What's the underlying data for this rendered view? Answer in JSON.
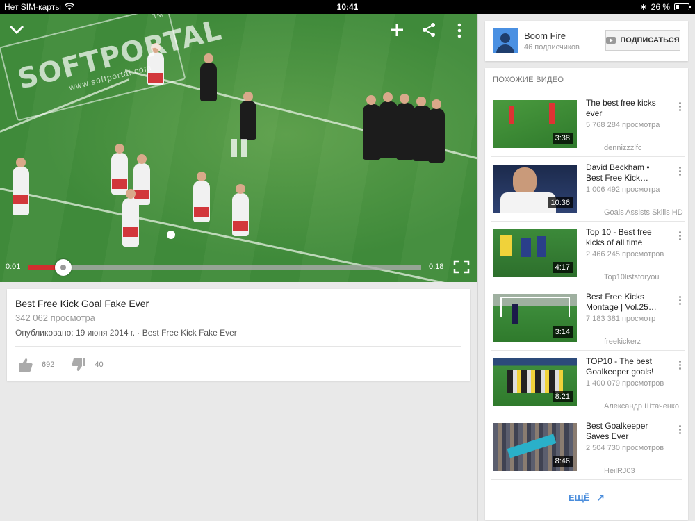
{
  "status_bar": {
    "carrier": "Нет SIM-карты",
    "time": "10:41",
    "battery_percent": "26 %",
    "battery_level": 0.26
  },
  "player": {
    "current_time": "0:01",
    "duration": "0:18",
    "progress": 0.09,
    "accent_color": "#d32f2f",
    "icons": [
      "chevron-down-icon",
      "add-icon",
      "share-icon",
      "more-vert-icon",
      "pause-icon",
      "fullscreen-icon"
    ]
  },
  "watermark": {
    "brand": "SOFTPORTAL",
    "url": "www.softportal.com",
    "tm": "TM"
  },
  "video_info": {
    "title": "Best Free Kick Goal Fake Ever",
    "views": "342 062 просмотра",
    "published": "Опубликовано: 19 июня 2014 г. · Best Free Kick Fake Ever",
    "likes": "692",
    "dislikes": "40"
  },
  "channel": {
    "name": "Boom Fire",
    "subscribers": "46 подписчиков",
    "subscribe_label": "ПОДПИСАТЬСЯ"
  },
  "related": {
    "heading": "ПОХОЖИЕ ВИДЕО",
    "items": [
      {
        "title": "The best free kicks ever",
        "views": "5 768 284 просмотра",
        "author": "dennizzzlfc",
        "duration": "3:38"
      },
      {
        "title": "David Beckham • Best Free Kick…",
        "views": "1 006 492 просмотра",
        "author": "Goals Assists Skills HD",
        "duration": "10:36"
      },
      {
        "title": "Top 10 - Best free kicks of all time",
        "views": "2 466 245 просмотров",
        "author": "Top10listsforyou",
        "duration": "4:17"
      },
      {
        "title": "Best Free Kicks Montage | Vol.25…",
        "views": "7 183 381 просмотр",
        "author": "freekickerz",
        "duration": "3:14"
      },
      {
        "title": "TOP10 - The best Goalkeeper goals!",
        "views": "1 400 079 просмотров",
        "author": "Александр Штаченко",
        "duration": "8:21"
      },
      {
        "title": "Best Goalkeeper Saves Ever",
        "views": "2 504 730 просмотров",
        "author": "HeilRJ03",
        "duration": "8:46"
      }
    ],
    "more_label": "ЕЩЁ",
    "link_color": "#4a8ddc"
  }
}
